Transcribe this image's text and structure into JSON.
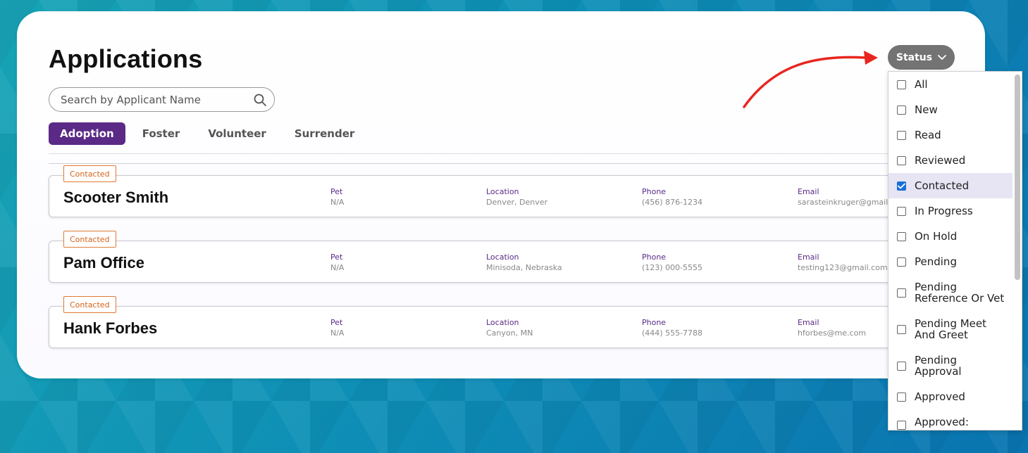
{
  "page": {
    "title": "Applications",
    "search": {
      "placeholder": "Search by Applicant Name",
      "value": ""
    }
  },
  "tabs": [
    {
      "label": "Adoption",
      "active": true
    },
    {
      "label": "Foster",
      "active": false
    },
    {
      "label": "Volunteer",
      "active": false
    },
    {
      "label": "Surrender",
      "active": false
    }
  ],
  "field_labels": {
    "pet": "Pet",
    "location": "Location",
    "phone": "Phone",
    "email": "Email"
  },
  "applications": [
    {
      "status": "Contacted",
      "name": "Scooter Smith",
      "pet": "N/A",
      "location": "Denver, Denver",
      "phone": "(456) 876-1234",
      "email": "sarasteinkruger@gmail.c"
    },
    {
      "status": "Contacted",
      "name": "Pam Office",
      "pet": "N/A",
      "location": "Minisoda, Nebraska",
      "phone": "(123) 000-5555",
      "email": "testing123@gmail.com"
    },
    {
      "status": "Contacted",
      "name": "Hank Forbes",
      "pet": "N/A",
      "location": "Canyon, MN",
      "phone": "(444) 555-7788",
      "email": "hforbes@me.com"
    }
  ],
  "status_filter": {
    "button_label": "Status",
    "options": [
      {
        "line1": "All",
        "line2": "",
        "checked": false
      },
      {
        "line1": "New",
        "line2": "",
        "checked": false
      },
      {
        "line1": "Read",
        "line2": "",
        "checked": false
      },
      {
        "line1": "Reviewed",
        "line2": "",
        "checked": false
      },
      {
        "line1": "Contacted",
        "line2": "",
        "checked": true
      },
      {
        "line1": "In Progress",
        "line2": "",
        "checked": false
      },
      {
        "line1": "On Hold",
        "line2": "",
        "checked": false
      },
      {
        "line1": "Pending",
        "line2": "",
        "checked": false
      },
      {
        "line1": "Pending",
        "line2": "Reference Or Vet",
        "checked": false
      },
      {
        "line1": "Pending Meet",
        "line2": "And Greet",
        "checked": false
      },
      {
        "line1": "Pending",
        "line2": "Approval",
        "checked": false
      },
      {
        "line1": "Approved",
        "line2": "",
        "checked": false
      },
      {
        "line1": "Approved:",
        "line2": "",
        "checked": false
      }
    ]
  },
  "colors": {
    "accent": "#5a2a86",
    "badge": "#d4621a",
    "status_button": "#737373",
    "selected_row": "#e7e4f4",
    "annotation_arrow": "#e8261f"
  }
}
